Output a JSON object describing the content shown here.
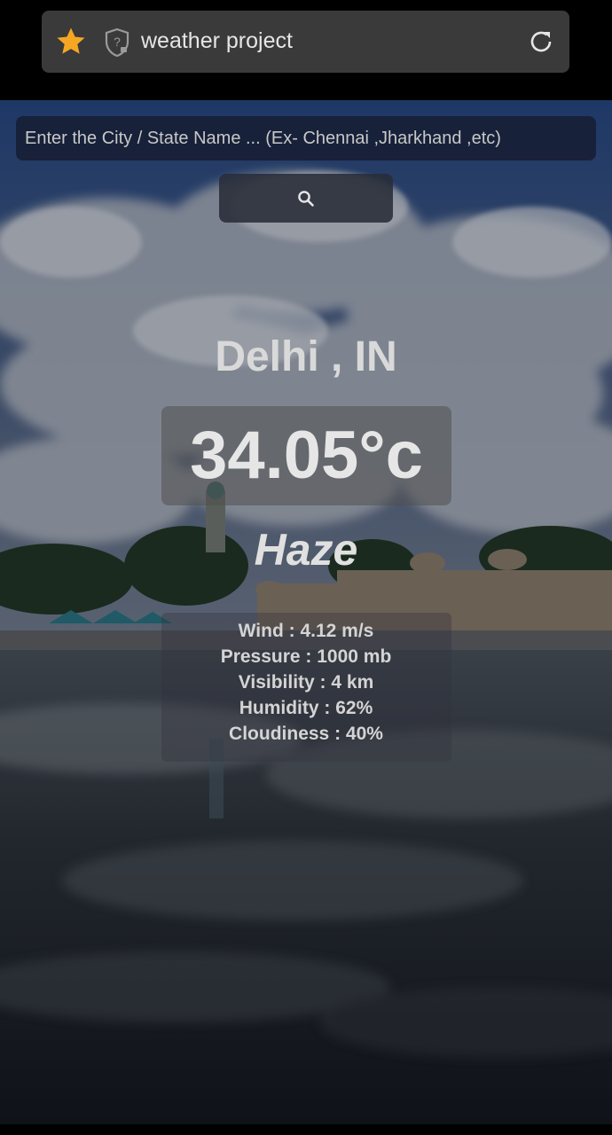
{
  "browser": {
    "tab_title": "weather project",
    "icons": {
      "bookmark": "star-icon",
      "site_info": "shield-question-icon",
      "reload": "reload-icon"
    },
    "colors": {
      "bar_bg": "#3a3a3a",
      "star": "#f5a623"
    }
  },
  "search": {
    "placeholder": "Enter the City / State Name ... (Ex- Chennai ,Jharkhand ,etc)",
    "value": "",
    "button_icon": "search-icon"
  },
  "weather": {
    "location": "Delhi , IN",
    "temperature": "34.05°c",
    "condition": "Haze",
    "details": {
      "wind": "Wind : 4.12 m/s",
      "pressure": "Pressure : 1000 mb",
      "visibility": "Visibility : 4 km",
      "humidity": "Humidity : 62%",
      "cloudiness": "Cloudiness : 40%"
    }
  }
}
